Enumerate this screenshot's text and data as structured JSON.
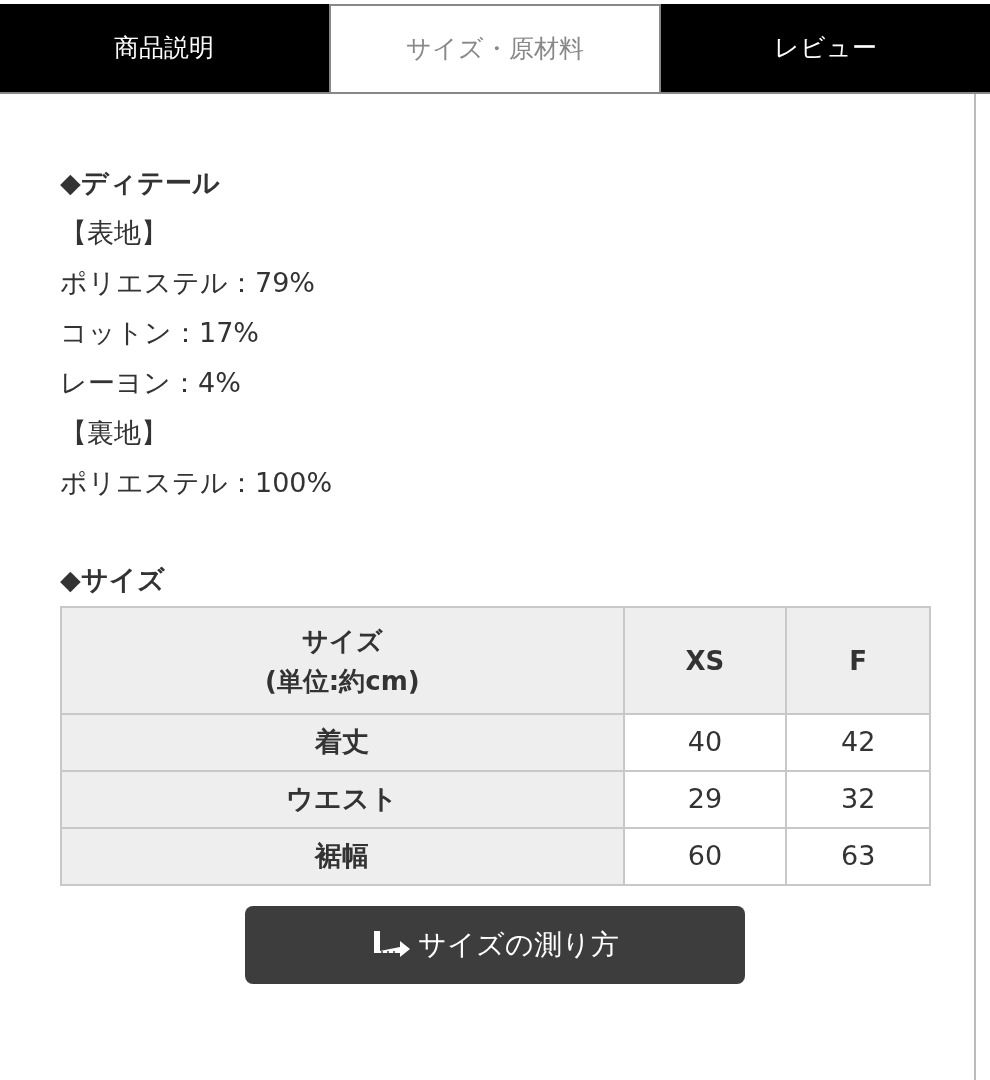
{
  "tabs": [
    {
      "label": "商品説明",
      "selected": false
    },
    {
      "label": "サイズ・原材料",
      "selected": true
    },
    {
      "label": "レビュー",
      "selected": false
    }
  ],
  "detail": {
    "heading": "◆ディテール",
    "lines": [
      "【表地】",
      "ポリエステル：79%",
      "コットン：17%",
      "レーヨン：4%",
      "【裏地】",
      "ポリエステル：100%"
    ]
  },
  "size": {
    "heading": "◆サイズ",
    "table": {
      "columns": [
        "サイズ\n(単位:約cm)",
        "XS",
        "F"
      ],
      "rows": [
        [
          "着丈",
          "40",
          "42"
        ],
        [
          "ウエスト",
          "29",
          "32"
        ],
        [
          "裾幅",
          "60",
          "63"
        ]
      ]
    }
  },
  "measure_button": {
    "label": "サイズの測り方"
  }
}
